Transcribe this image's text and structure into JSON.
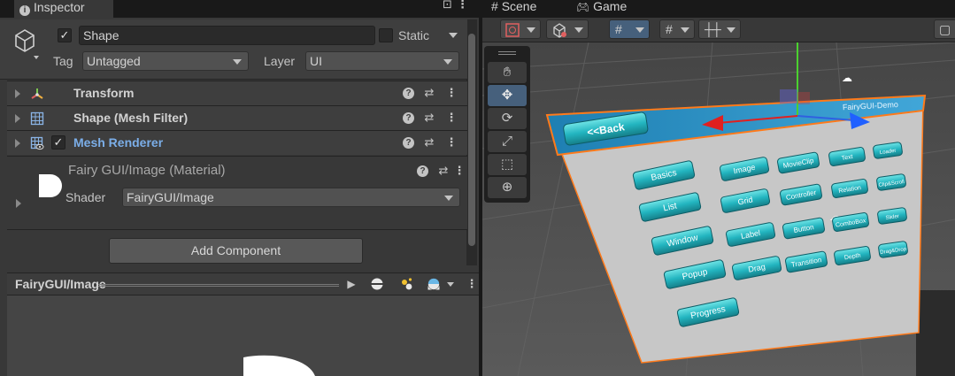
{
  "inspector": {
    "tab_label": "Inspector",
    "object": {
      "name": "Shape",
      "active": true,
      "static_label": "Static"
    },
    "tag": {
      "label": "Tag",
      "value": "Untagged"
    },
    "layer": {
      "label": "Layer",
      "value": "UI"
    },
    "components": [
      {
        "name": "Transform",
        "icon": "transform-icon"
      },
      {
        "name": "Shape (Mesh Filter)",
        "icon": "mesh-filter-icon"
      },
      {
        "name": "Mesh Renderer",
        "icon": "mesh-renderer-icon",
        "enabled": true,
        "color": "#7baee8"
      }
    ],
    "material": {
      "name": "Fairy GUI/Image (Material)",
      "shader_label": "Shader",
      "shader_value": "FairyGUI/Image"
    },
    "add_component_label": "Add Component",
    "preview": {
      "title": "FairyGUI/Image"
    }
  },
  "scene": {
    "tabs": [
      {
        "label": "Scene",
        "icon": "grid-icon"
      },
      {
        "label": "Game",
        "icon": "gamepad-icon"
      }
    ],
    "tools": [
      "hand-tool",
      "move-tool",
      "rotate-tool",
      "scale-tool",
      "rect-tool",
      "transform-tool"
    ],
    "active_tool": "move-tool",
    "ui_panel": {
      "title": "FairyGUI-Demo",
      "back_label": "<<Back",
      "buttons": [
        "Basics",
        "Image",
        "MovieClip",
        "Text",
        "Loader",
        "List",
        "Grid",
        "Controller",
        "Relation",
        "Clip&Scroll",
        "Window",
        "Label",
        "Button",
        "ComboBox",
        "Slider",
        "Popup",
        "Drag",
        "Transition",
        "Depth",
        "Drag&Drop",
        "Progress"
      ]
    },
    "colors": {
      "selection": "#ff7a1a",
      "panel_header": "#2596c8",
      "button": "#29c2c8"
    }
  }
}
